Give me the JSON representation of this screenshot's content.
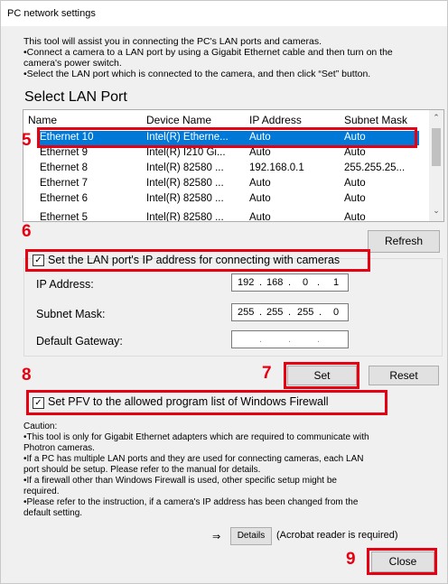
{
  "window": {
    "title": "PC network settings"
  },
  "intro": [
    "This tool will assist you in connecting the PC's LAN ports and cameras.",
    "•Connect a camera to a LAN port by using a Gigabit Ethernet cable and then turn on the",
    "camera's power switch.",
    "•Select the LAN port which is connected to the camera, and then click “Set” button."
  ],
  "lan_section": {
    "title": "Select LAN Port",
    "columns": [
      "Name",
      "Device Name",
      "IP Address",
      "Subnet Mask"
    ],
    "rows": [
      {
        "name": "Ethernet 10",
        "device": "Intel(R) Etherne...",
        "ip": "Auto",
        "mask": "Auto",
        "selected": true
      },
      {
        "name": "Ethernet 9",
        "device": "Intel(R) I210 Gi...",
        "ip": "Auto",
        "mask": "Auto"
      },
      {
        "name": "Ethernet 8",
        "device": "Intel(R) 82580 ...",
        "ip": "192.168.0.1",
        "mask": "255.255.25..."
      },
      {
        "name": "Ethernet 7",
        "device": "Intel(R) 82580 ...",
        "ip": "Auto",
        "mask": "Auto"
      },
      {
        "name": "Ethernet 6",
        "device": "Intel(R) 82580 ...",
        "ip": "Auto",
        "mask": "Auto"
      },
      {
        "name": "Ethernet 5",
        "device": "Intel(R) 82580 ...",
        "ip": "Auto",
        "mask": "Auto"
      }
    ],
    "refresh_label": "Refresh"
  },
  "ip_group": {
    "checkbox_label": "Set the LAN port's IP address for connecting with cameras",
    "checked": true,
    "ip_label": "IP Address:",
    "ip_value": [
      "192",
      "168",
      "0",
      "1"
    ],
    "mask_label": "Subnet Mask:",
    "mask_value": [
      "255",
      "255",
      "255",
      "0"
    ],
    "gateway_label": "Default Gateway:",
    "gateway_value": [
      "",
      "",
      "",
      ""
    ]
  },
  "buttons": {
    "set": "Set",
    "reset": "Reset",
    "close": "Close",
    "details": "Details"
  },
  "firewall": {
    "label": "Set PFV to the allowed program list of Windows Firewall",
    "checked": true
  },
  "caution": [
    "Caution:",
    "•This tool is only for Gigabit Ethernet adapters which are required to communicate with",
    "Photron cameras.",
    "•If a PC has multiple LAN ports and they are used for connecting cameras, each LAN",
    "port should be setup. Please refer to the manual for details.",
    "•If a firewall other than Windows Firewall is used, other specific setup might be",
    "required.",
    "•Please refer to the instruction, if a camera's IP address has been changed from the",
    "default setting."
  ],
  "details_note": "(Acrobat reader is required)",
  "details_arrow": "⇒",
  "annotations": {
    "n5": "5",
    "n6": "6",
    "n7": "7",
    "n8": "8",
    "n9": "9",
    "color": "#e60012"
  }
}
